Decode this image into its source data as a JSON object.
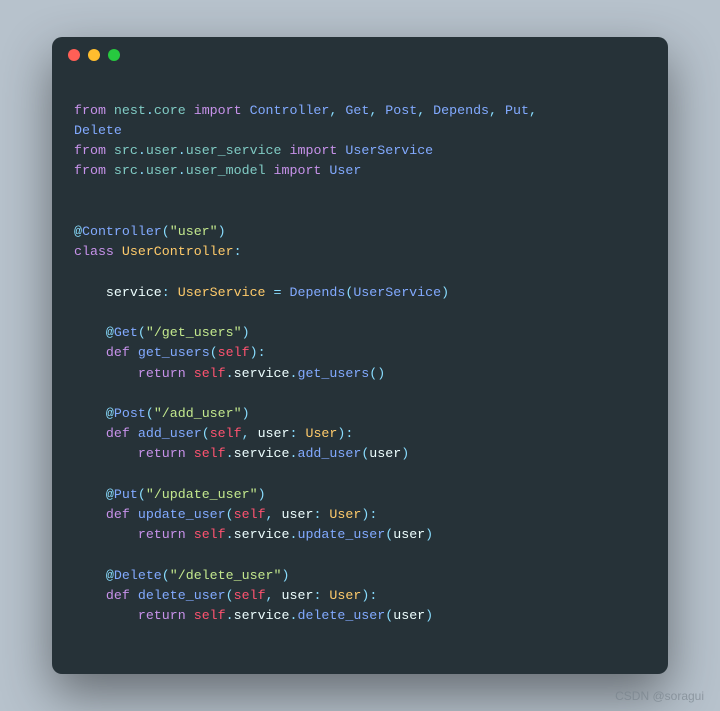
{
  "window": {
    "dots": [
      "red",
      "yellow",
      "green"
    ]
  },
  "code": {
    "lines": [
      [
        ""
      ],
      [
        [
          "kw",
          "from"
        ],
        [
          "",
          " "
        ],
        [
          "name",
          "nest"
        ],
        [
          "pn",
          "."
        ],
        [
          "name",
          "core"
        ],
        [
          "",
          " "
        ],
        [
          "kw",
          "import"
        ],
        [
          "",
          " "
        ],
        [
          "fn",
          "Controller"
        ],
        [
          "pn",
          ","
        ],
        [
          "",
          " "
        ],
        [
          "fn",
          "Get"
        ],
        [
          "pn",
          ","
        ],
        [
          "",
          " "
        ],
        [
          "fn",
          "Post"
        ],
        [
          "pn",
          ","
        ],
        [
          "",
          " "
        ],
        [
          "fn",
          "Depends"
        ],
        [
          "pn",
          ","
        ],
        [
          "",
          " "
        ],
        [
          "fn",
          "Put"
        ],
        [
          "pn",
          ","
        ],
        [
          "",
          " "
        ]
      ],
      [
        [
          "fn",
          "Delete"
        ]
      ],
      [
        [
          "kw",
          "from"
        ],
        [
          "",
          " "
        ],
        [
          "name",
          "src"
        ],
        [
          "pn",
          "."
        ],
        [
          "name",
          "user"
        ],
        [
          "pn",
          "."
        ],
        [
          "name",
          "user_service"
        ],
        [
          "",
          " "
        ],
        [
          "kw",
          "import"
        ],
        [
          "",
          " "
        ],
        [
          "fn",
          "UserService"
        ]
      ],
      [
        [
          "kw",
          "from"
        ],
        [
          "",
          " "
        ],
        [
          "name",
          "src"
        ],
        [
          "pn",
          "."
        ],
        [
          "name",
          "user"
        ],
        [
          "pn",
          "."
        ],
        [
          "name",
          "user_model"
        ],
        [
          "",
          " "
        ],
        [
          "kw",
          "import"
        ],
        [
          "",
          " "
        ],
        [
          "fn",
          "User"
        ]
      ],
      [
        ""
      ],
      [
        ""
      ],
      [
        [
          "pn",
          "@"
        ],
        [
          "fn",
          "Controller"
        ],
        [
          "pn",
          "("
        ],
        [
          "str",
          "\"user\""
        ],
        [
          "pn",
          ")"
        ]
      ],
      [
        [
          "kw",
          "class"
        ],
        [
          "",
          " "
        ],
        [
          "cls",
          "UserController"
        ],
        [
          "pn",
          ":"
        ]
      ],
      [
        ""
      ],
      [
        [
          "",
          "    "
        ],
        [
          "white",
          "service"
        ],
        [
          "pn",
          ":"
        ],
        [
          "",
          " "
        ],
        [
          "cls",
          "UserService"
        ],
        [
          "",
          " "
        ],
        [
          "pn",
          "="
        ],
        [
          "",
          " "
        ],
        [
          "fn",
          "Depends"
        ],
        [
          "pn",
          "("
        ],
        [
          "fn",
          "UserService"
        ],
        [
          "pn",
          ")"
        ]
      ],
      [
        ""
      ],
      [
        [
          "",
          "    "
        ],
        [
          "pn",
          "@"
        ],
        [
          "fn",
          "Get"
        ],
        [
          "pn",
          "("
        ],
        [
          "str",
          "\"/get_users\""
        ],
        [
          "pn",
          ")"
        ]
      ],
      [
        [
          "",
          "    "
        ],
        [
          "kw",
          "def"
        ],
        [
          "",
          " "
        ],
        [
          "fn",
          "get_users"
        ],
        [
          "pn",
          "("
        ],
        [
          "self",
          "self"
        ],
        [
          "pn",
          ")"
        ],
        [
          "pn",
          ":"
        ]
      ],
      [
        [
          "",
          "        "
        ],
        [
          "kw",
          "return"
        ],
        [
          "",
          " "
        ],
        [
          "self",
          "self"
        ],
        [
          "pn",
          "."
        ],
        [
          "white",
          "service"
        ],
        [
          "pn",
          "."
        ],
        [
          "fn",
          "get_users"
        ],
        [
          "pn",
          "("
        ],
        [
          "pn",
          ")"
        ]
      ],
      [
        ""
      ],
      [
        [
          "",
          "    "
        ],
        [
          "pn",
          "@"
        ],
        [
          "fn",
          "Post"
        ],
        [
          "pn",
          "("
        ],
        [
          "str",
          "\"/add_user\""
        ],
        [
          "pn",
          ")"
        ]
      ],
      [
        [
          "",
          "    "
        ],
        [
          "kw",
          "def"
        ],
        [
          "",
          " "
        ],
        [
          "fn",
          "add_user"
        ],
        [
          "pn",
          "("
        ],
        [
          "self",
          "self"
        ],
        [
          "pn",
          ","
        ],
        [
          "",
          " "
        ],
        [
          "white",
          "user"
        ],
        [
          "pn",
          ":"
        ],
        [
          "",
          " "
        ],
        [
          "cls",
          "User"
        ],
        [
          "pn",
          ")"
        ],
        [
          "pn",
          ":"
        ]
      ],
      [
        [
          "",
          "        "
        ],
        [
          "kw",
          "return"
        ],
        [
          "",
          " "
        ],
        [
          "self",
          "self"
        ],
        [
          "pn",
          "."
        ],
        [
          "white",
          "service"
        ],
        [
          "pn",
          "."
        ],
        [
          "fn",
          "add_user"
        ],
        [
          "pn",
          "("
        ],
        [
          "white",
          "user"
        ],
        [
          "pn",
          ")"
        ]
      ],
      [
        ""
      ],
      [
        [
          "",
          "    "
        ],
        [
          "pn",
          "@"
        ],
        [
          "fn",
          "Put"
        ],
        [
          "pn",
          "("
        ],
        [
          "str",
          "\"/update_user\""
        ],
        [
          "pn",
          ")"
        ]
      ],
      [
        [
          "",
          "    "
        ],
        [
          "kw",
          "def"
        ],
        [
          "",
          " "
        ],
        [
          "fn",
          "update_user"
        ],
        [
          "pn",
          "("
        ],
        [
          "self",
          "self"
        ],
        [
          "pn",
          ","
        ],
        [
          "",
          " "
        ],
        [
          "white",
          "user"
        ],
        [
          "pn",
          ":"
        ],
        [
          "",
          " "
        ],
        [
          "cls",
          "User"
        ],
        [
          "pn",
          ")"
        ],
        [
          "pn",
          ":"
        ]
      ],
      [
        [
          "",
          "        "
        ],
        [
          "kw",
          "return"
        ],
        [
          "",
          " "
        ],
        [
          "self",
          "self"
        ],
        [
          "pn",
          "."
        ],
        [
          "white",
          "service"
        ],
        [
          "pn",
          "."
        ],
        [
          "fn",
          "update_user"
        ],
        [
          "pn",
          "("
        ],
        [
          "white",
          "user"
        ],
        [
          "pn",
          ")"
        ]
      ],
      [
        ""
      ],
      [
        [
          "",
          "    "
        ],
        [
          "pn",
          "@"
        ],
        [
          "fn",
          "Delete"
        ],
        [
          "pn",
          "("
        ],
        [
          "str",
          "\"/delete_user\""
        ],
        [
          "pn",
          ")"
        ]
      ],
      [
        [
          "",
          "    "
        ],
        [
          "kw",
          "def"
        ],
        [
          "",
          " "
        ],
        [
          "fn",
          "delete_user"
        ],
        [
          "pn",
          "("
        ],
        [
          "self",
          "self"
        ],
        [
          "pn",
          ","
        ],
        [
          "",
          " "
        ],
        [
          "white",
          "user"
        ],
        [
          "pn",
          ":"
        ],
        [
          "",
          " "
        ],
        [
          "cls",
          "User"
        ],
        [
          "pn",
          ")"
        ],
        [
          "pn",
          ":"
        ]
      ],
      [
        [
          "",
          "        "
        ],
        [
          "kw",
          "return"
        ],
        [
          "",
          " "
        ],
        [
          "self",
          "self"
        ],
        [
          "pn",
          "."
        ],
        [
          "white",
          "service"
        ],
        [
          "pn",
          "."
        ],
        [
          "fn",
          "delete_user"
        ],
        [
          "pn",
          "("
        ],
        [
          "white",
          "user"
        ],
        [
          "pn",
          ")"
        ]
      ],
      [
        ""
      ]
    ]
  },
  "watermark": "CSDN @soragui"
}
